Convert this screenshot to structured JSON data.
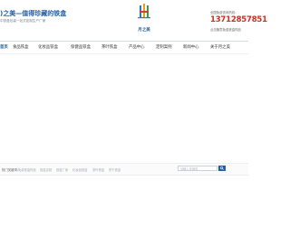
{
  "header": {
    "slogan": ")之美—值得珍藏的铁盒",
    "subtitle": "中铁盒包装一站式定制生产厂家",
    "logo_text": "月之美",
    "contact_label": "全国免费咨询热线：",
    "hotline": "13712857851",
    "contact_tip": "点击随意免费铁盒样品"
  },
  "colors": {
    "brand": "#1f5ea8",
    "hotline": "#c6321e"
  },
  "nav": {
    "items": [
      {
        "label": "首页",
        "active": true
      },
      {
        "label": "食品铁盒",
        "active": false
      },
      {
        "label": "化妆品铁盒",
        "active": false
      },
      {
        "label": "保健品铁盒",
        "active": false
      },
      {
        "label": "茶叶铁盒",
        "active": false
      },
      {
        "label": "产品中心",
        "active": false
      },
      {
        "label": "定制案例",
        "active": false
      },
      {
        "label": "新闻中心",
        "active": false
      },
      {
        "label": "关于月之美",
        "active": false
      }
    ]
  },
  "search_bar": {
    "label": "热门关键词：",
    "keywords": [
      "免费铁盒样品",
      "铁盒定制",
      "铁盒厂家",
      "化妆品铁盒",
      "茶叶铁盒",
      "饼干铁盒"
    ],
    "placeholder": "请输入关键词"
  }
}
